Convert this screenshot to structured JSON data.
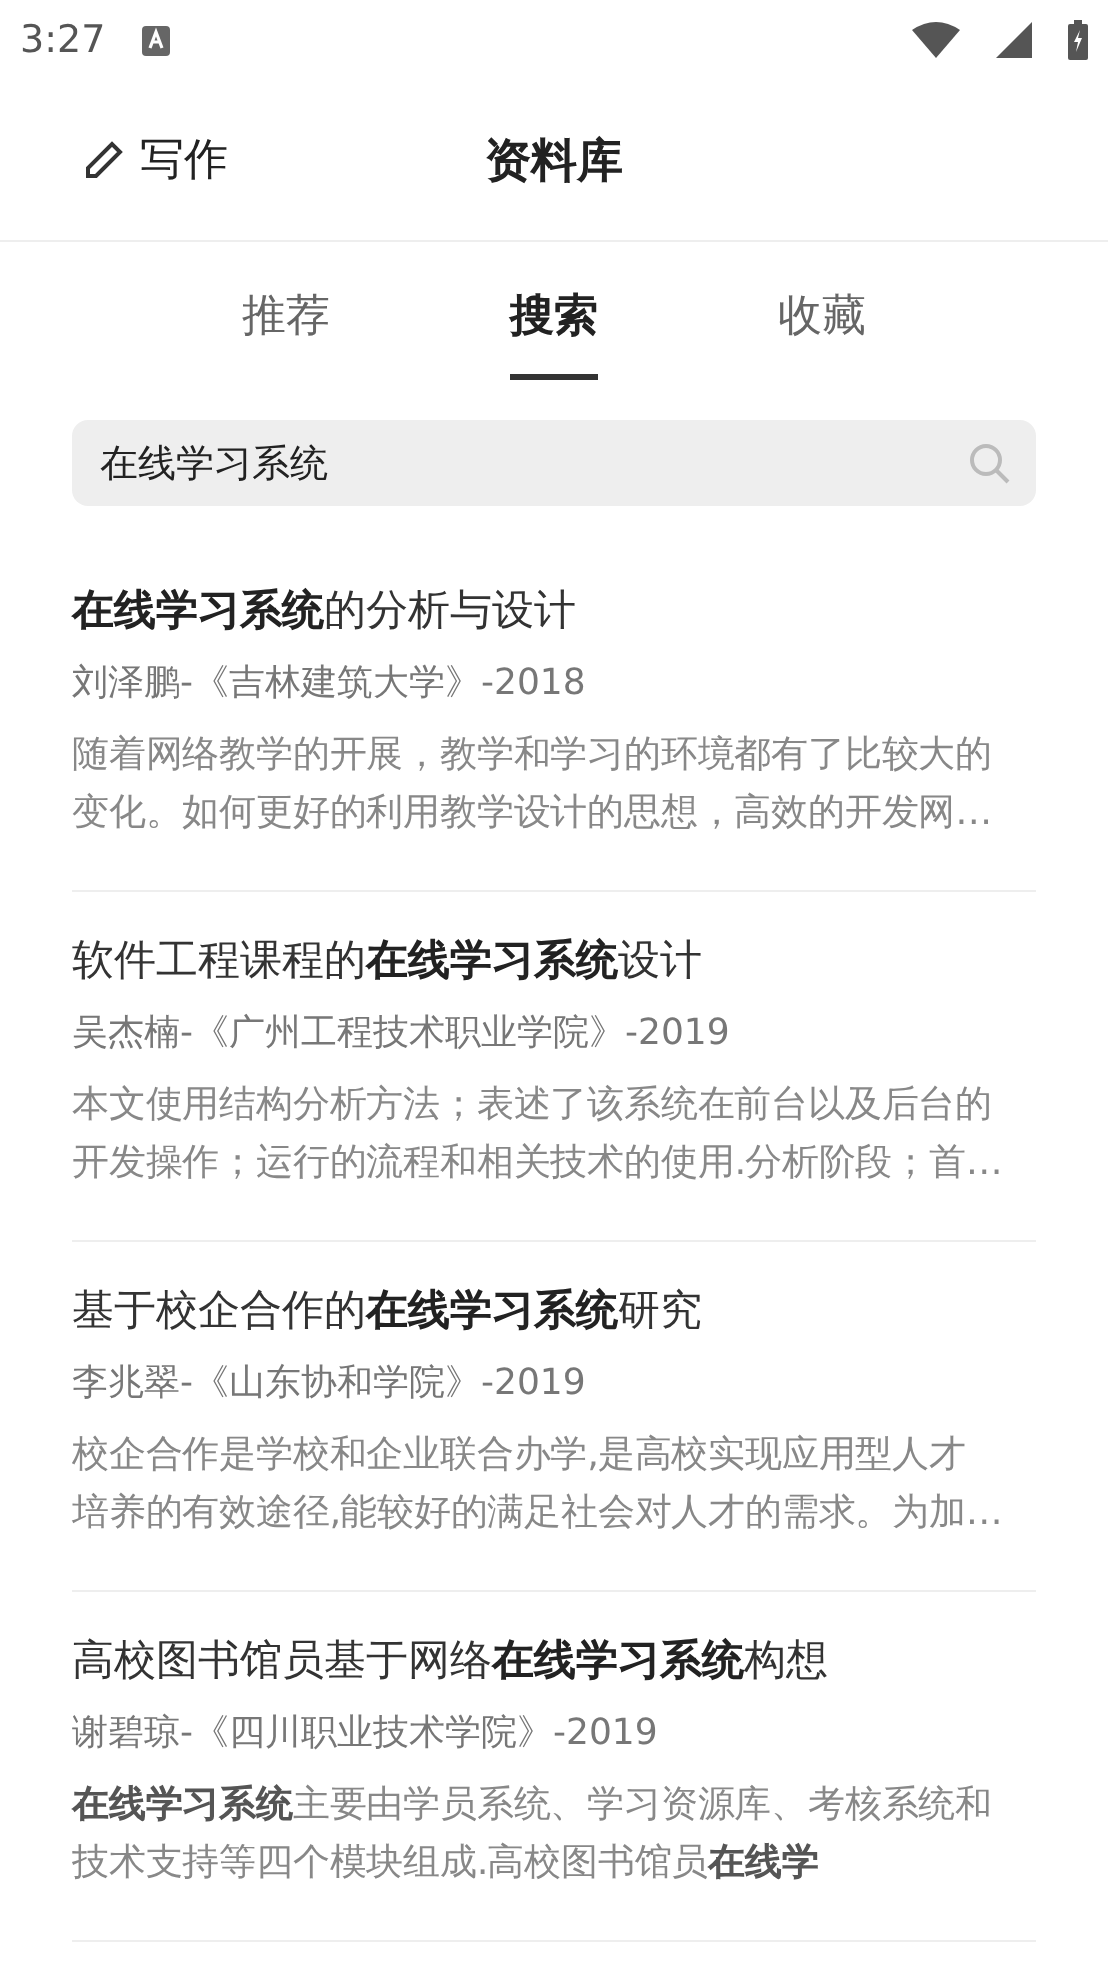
{
  "status_bar": {
    "time": "3:27"
  },
  "header": {
    "write_label": "写作",
    "title": "资料库"
  },
  "tabs": [
    {
      "label": "推荐",
      "selected": false
    },
    {
      "label": "搜索",
      "selected": true
    },
    {
      "label": "收藏",
      "selected": false
    }
  ],
  "search": {
    "value": "在线学习系统"
  },
  "results": [
    {
      "title": "**在线学习系统**的分析与设计",
      "meta": "刘泽鹏-《吉林建筑大学》-2018",
      "abstract": [
        "随着网络教学的开展，教学和学习的环境都有了比较大的",
        "变化。如何更好的利用教学设计的思想，高效的开发网…"
      ]
    },
    {
      "title": "软件工程课程的**在线学习系统**设计",
      "meta": "吴杰楠-《广州工程技术职业学院》-2019",
      "abstract": [
        "本文使用结构分析方法；表述了该系统在前台以及后台的",
        "开发操作；运行的流程和相关技术的使用.分析阶段；首…"
      ]
    },
    {
      "title": "基于校企合作的**在线学习系统**研究",
      "meta": "李兆翠-《山东协和学院》-2019",
      "abstract": [
        "校企合作是学校和企业联合办学,是高校实现应用型人才",
        "培养的有效途径,能较好的满足社会对人才的需求。为加…"
      ]
    },
    {
      "title": "高校图书馆员基于网络**在线学习系统**构想",
      "meta": "谢碧琼-《四川职业技术学院》-2019",
      "abstract": [
        "**在线学习系统**主要由学员系统、学习资源库、考核系统和",
        "技术支持等四个模块组成.高校图书馆员**在线学**"
      ]
    }
  ]
}
